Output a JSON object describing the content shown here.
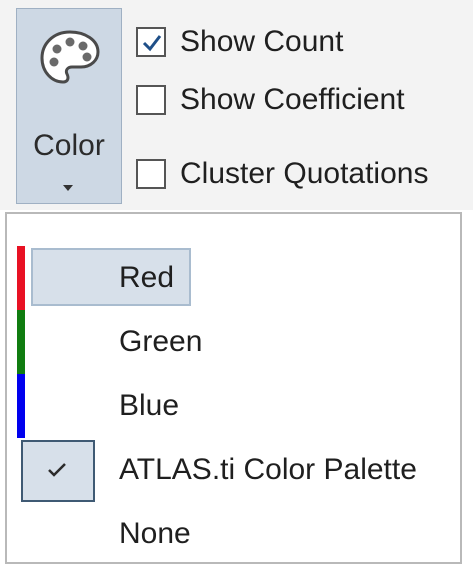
{
  "ribbon": {
    "color_button": {
      "label": "Color",
      "icon": "palette-icon"
    },
    "options": [
      {
        "label": "Show Count",
        "checked": true
      },
      {
        "label": "Show Coefficient",
        "checked": false
      },
      {
        "label": "Cluster Quotations",
        "checked": false
      }
    ]
  },
  "menu": {
    "items": [
      {
        "label": "Red",
        "strip_color": "#e81123",
        "state": "hover"
      },
      {
        "label": "Green",
        "strip_color": "#107c10",
        "state": "normal"
      },
      {
        "label": "Blue",
        "strip_color": "#0000ee",
        "state": "normal"
      },
      {
        "label": "ATLAS.ti Color Palette",
        "state": "checked"
      },
      {
        "label": "None",
        "state": "normal"
      }
    ]
  }
}
